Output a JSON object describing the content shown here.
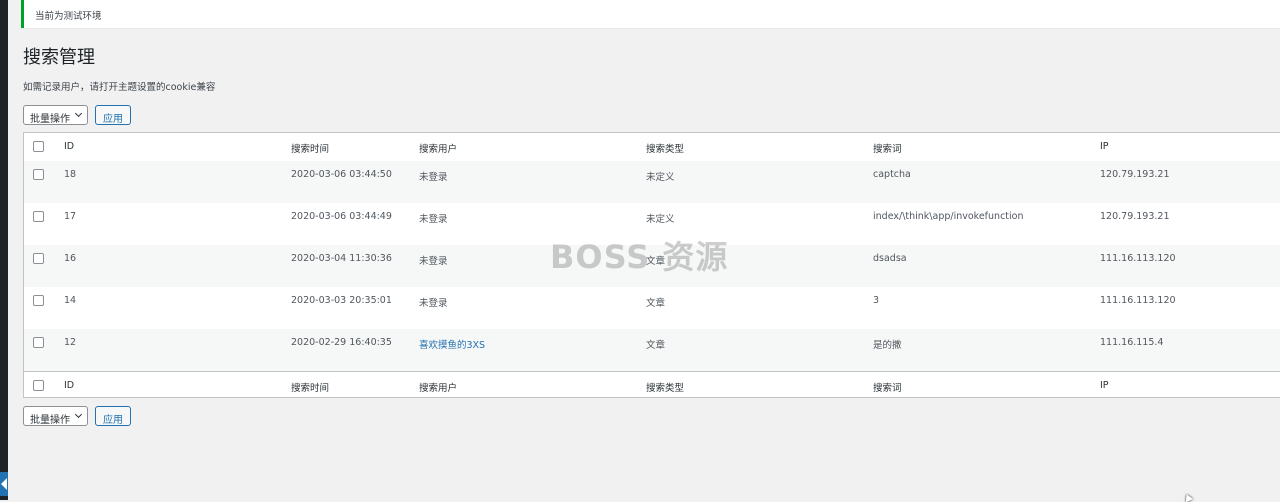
{
  "notice": {
    "text": "当前为测试环境"
  },
  "page": {
    "title": "搜索管理",
    "description": "如需记录用户，请打开主题设置的cookie兼容"
  },
  "tablenav": {
    "bulk_label": "批量操作",
    "apply_label": "应用",
    "edge_count": "5"
  },
  "columns": {
    "id": "ID",
    "time": "搜索时间",
    "user": "搜索用户",
    "type": "搜索类型",
    "term": "搜索词",
    "ip": "IP"
  },
  "rows": [
    {
      "id": "18",
      "time": "2020-03-06 03:44:50",
      "user": "未登录",
      "type": "未定义",
      "term": "captcha",
      "ip": "120.79.193.21"
    },
    {
      "id": "17",
      "time": "2020-03-06 03:44:49",
      "user": "未登录",
      "type": "未定义",
      "term": "index/\\think\\app/invokefunction",
      "ip": "120.79.193.21"
    },
    {
      "id": "16",
      "time": "2020-03-04 11:30:36",
      "user": "未登录",
      "type": "文章",
      "term": "dsadsa",
      "ip": "111.16.113.120"
    },
    {
      "id": "14",
      "time": "2020-03-03 20:35:01",
      "user": "未登录",
      "type": "文章",
      "term": "3",
      "ip": "111.16.113.120"
    },
    {
      "id": "12",
      "time": "2020-02-29 16:40:35",
      "user": "喜欢摸鱼的3XS",
      "type": "文章",
      "term": "是的撒",
      "ip": "111.16.115.4"
    }
  ],
  "watermark": "BOSS 资源",
  "colors": {
    "accent": "#2271b1",
    "notice_border": "#00a32a",
    "admin_bar": "#1d2327"
  }
}
